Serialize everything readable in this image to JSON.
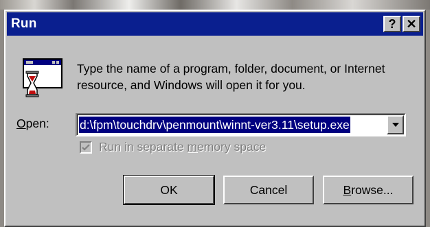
{
  "window": {
    "title": "Run",
    "help_button": "?",
    "close_button": "✕"
  },
  "message": "Type the name of a program, folder, document, or Internet resource, and Windows will open it for you.",
  "open_field": {
    "label_underlined": "O",
    "label_rest": "pen:",
    "value": "d:\\fpm\\touchdrv\\penmount\\winnt-ver3.11\\setup.exe"
  },
  "separate_memory": {
    "label_before": "Run in separate ",
    "label_underlined": "m",
    "label_after": "emory space",
    "checked": true,
    "enabled": false
  },
  "buttons": {
    "ok": "OK",
    "cancel": "Cancel",
    "browse_underlined": "B",
    "browse_rest": "rowse..."
  },
  "colors": {
    "titlebar": "#0a1f8f",
    "face": "#c0c0c0",
    "selection": "#000080"
  },
  "icons": {
    "dialog_icon": "run-program-icon",
    "combo_arrow": "chevron-down-icon",
    "check": "check-icon"
  }
}
